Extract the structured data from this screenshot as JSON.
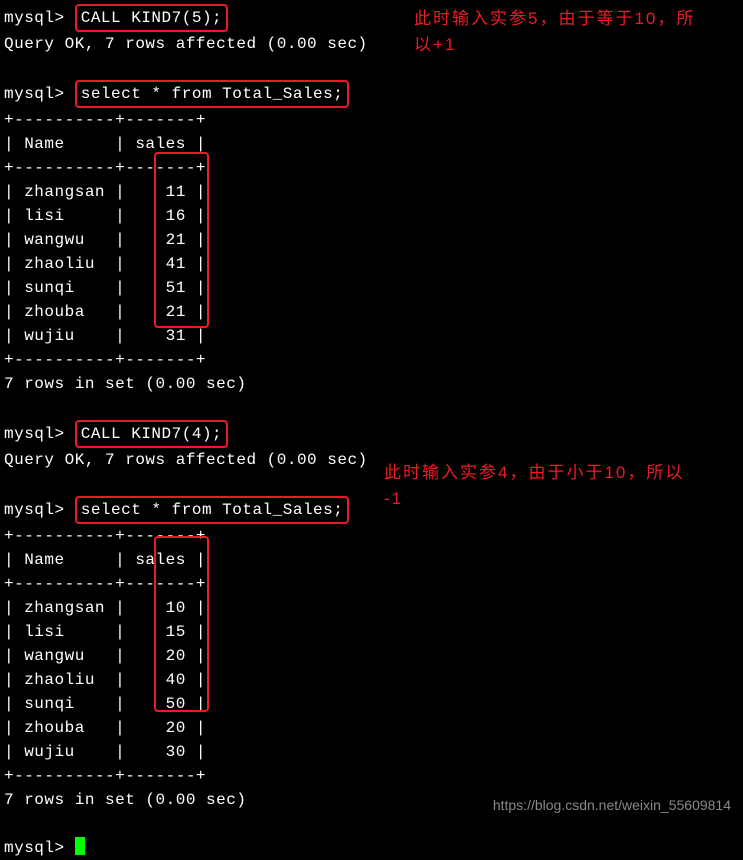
{
  "prompt": "mysql>",
  "cmd1": "CALL KIND7(5);",
  "result1": "Query OK, 7 rows affected (0.00 sec)",
  "annotation1_line1": "此时输入实参5，由于等于10，所",
  "annotation1_line2": "以+1",
  "cmd2": "select * from Total_Sales;",
  "table1": {
    "sep_top": "+----------+-------+",
    "header": "| Name     | sales |",
    "sep_mid": "+----------+-------+",
    "rows": [
      "| zhangsan |    11 |",
      "| lisi     |    16 |",
      "| wangwu   |    21 |",
      "| zhaoliu  |    41 |",
      "| sunqi    |    51 |",
      "| zhouba   |    21 |",
      "| wujiu    |    31 |"
    ],
    "sep_bot": "+----------+-------+",
    "footer": "7 rows in set (0.00 sec)"
  },
  "cmd3": "CALL KIND7(4);",
  "result3": "Query OK, 7 rows affected (0.00 sec)",
  "cmd4": "select * from Total_Sales;",
  "annotation2_line1": "此时输入实参4，由于小于10，所以",
  "annotation2_line2": "-1",
  "table2": {
    "sep_top": "+----------+-------+",
    "header": "| Name     | sales |",
    "sep_mid": "+----------+-------+",
    "rows": [
      "| zhangsan |    10 |",
      "| lisi     |    15 |",
      "| wangwu   |    20 |",
      "| zhaoliu  |    40 |",
      "| sunqi    |    50 |",
      "| zhouba   |    20 |",
      "| wujiu    |    30 |"
    ],
    "sep_bot": "+----------+-------+",
    "footer": "7 rows in set (0.00 sec)"
  },
  "watermark": "https://blog.csdn.net/weixin_55609814",
  "chart_data": {
    "type": "table",
    "tables": [
      {
        "title": "Total_Sales after CALL KIND7(5)",
        "columns": [
          "Name",
          "sales"
        ],
        "rows": [
          [
            "zhangsan",
            11
          ],
          [
            "lisi",
            16
          ],
          [
            "wangwu",
            21
          ],
          [
            "zhaoliu",
            41
          ],
          [
            "sunqi",
            51
          ],
          [
            "zhouba",
            21
          ],
          [
            "wujiu",
            31
          ]
        ]
      },
      {
        "title": "Total_Sales after CALL KIND7(4)",
        "columns": [
          "Name",
          "sales"
        ],
        "rows": [
          [
            "zhangsan",
            10
          ],
          [
            "lisi",
            15
          ],
          [
            "wangwu",
            20
          ],
          [
            "zhaoliu",
            40
          ],
          [
            "sunqi",
            50
          ],
          [
            "zhouba",
            20
          ],
          [
            "wujiu",
            30
          ]
        ]
      }
    ]
  }
}
